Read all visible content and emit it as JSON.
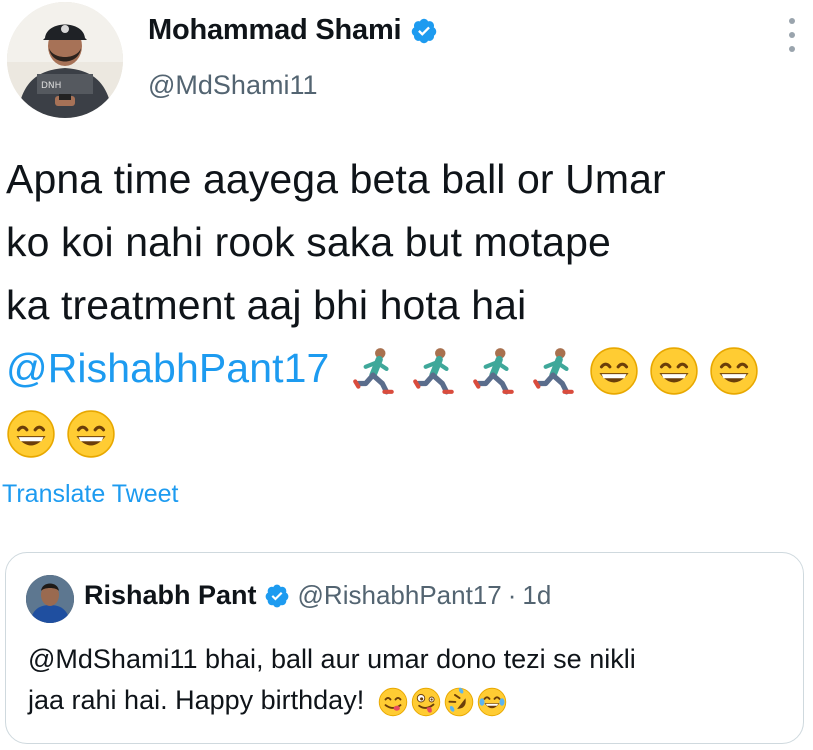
{
  "tweet": {
    "author_name": "Mohammad Shami",
    "author_handle": "@MdShami11",
    "text_line1": "Apna time aayega beta ball or Umar",
    "text_line2": "ko koi nahi rook saka but motape",
    "text_line3": "ka treatment aaj bhi hota hai",
    "mention": "@RishabhPant17",
    "emojis_line4": [
      "man-running-icon",
      "man-running-icon",
      "man-running-icon",
      "man-running-icon",
      "grinning-face-icon",
      "grinning-face-icon",
      "grinning-face-icon"
    ],
    "emojis_line5": [
      "grinning-face-icon",
      "grinning-face-icon"
    ],
    "translate_label": "Translate Tweet"
  },
  "quote": {
    "author_name": "Rishabh Pant",
    "author_handle": "@RishabhPant17",
    "separator": "·",
    "time": "1d",
    "text_line1": "@MdShami11 bhai, ball aur umar dono tezi se nikli",
    "text_line2": "jaa rahi hai. Happy birthday!",
    "emojis": [
      "face-savoring-food-icon",
      "zany-face-icon",
      "rolling-laughing-icon",
      "tears-of-joy-icon"
    ]
  },
  "colors": {
    "link": "#1d9bf0",
    "secondary_text": "#536471",
    "verified_badge": "#1d9bf0",
    "border": "#cfd9de"
  }
}
